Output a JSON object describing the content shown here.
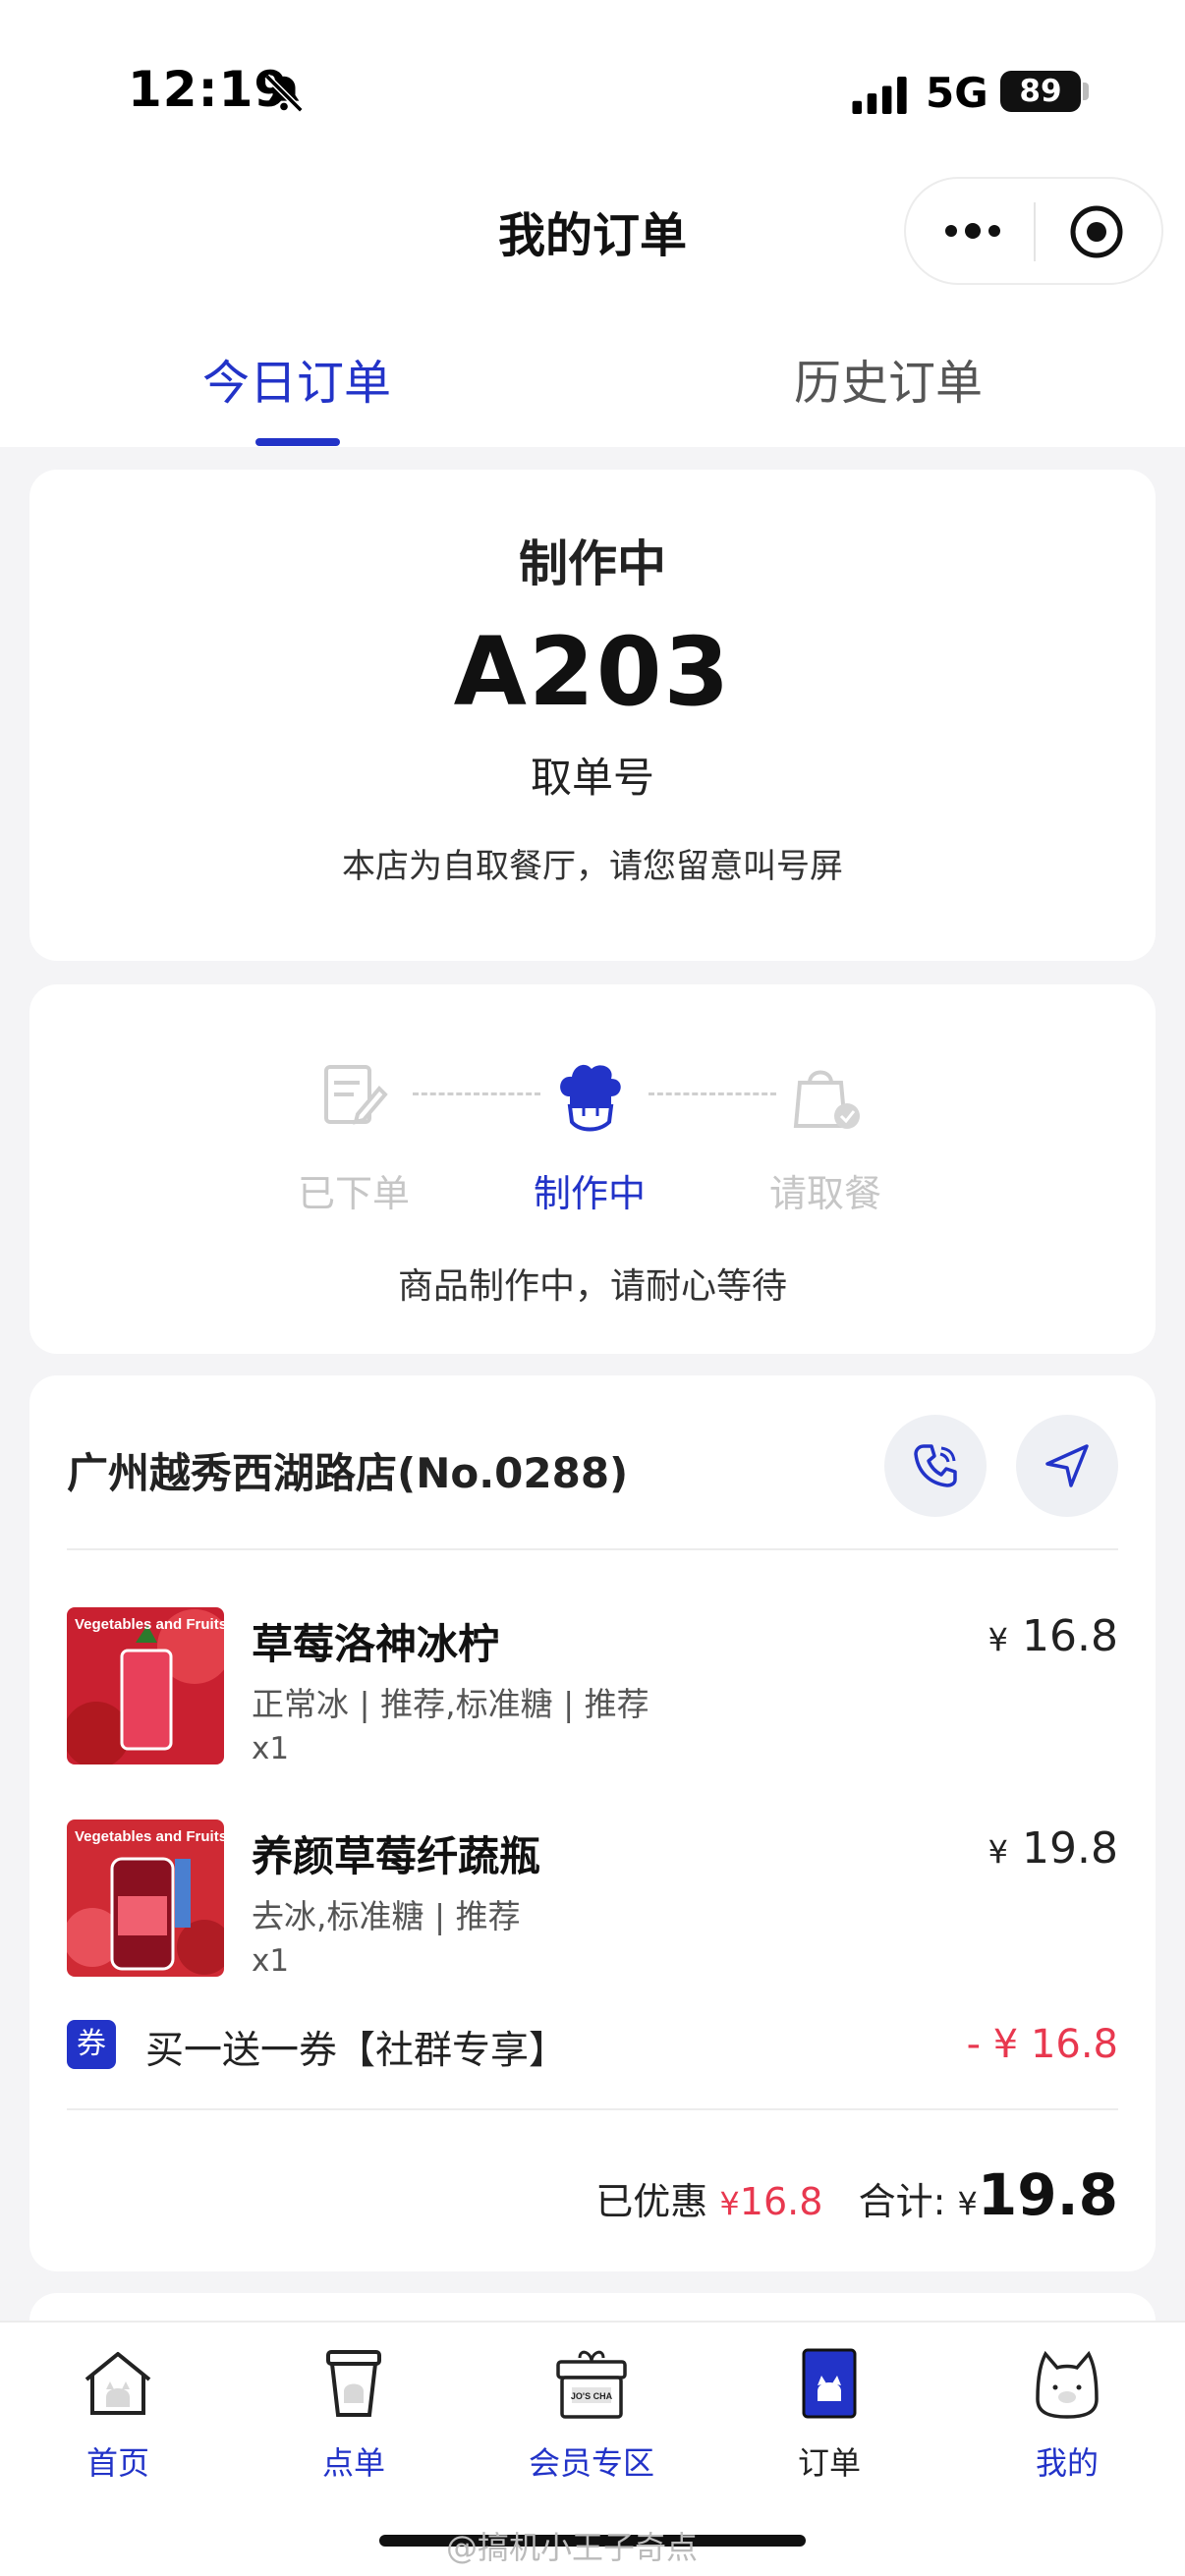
{
  "status_bar": {
    "time": "12:19",
    "network": "5G",
    "battery": "89"
  },
  "nav": {
    "title": "我的订单"
  },
  "tabs": [
    {
      "label": "今日订单",
      "active": true
    },
    {
      "label": "历史订单",
      "active": false
    }
  ],
  "order_status": {
    "status": "制作中",
    "pickup_number": "A203",
    "pickup_label": "取单号",
    "note": "本店为自取餐厅，请您留意叫号屏"
  },
  "progress": {
    "steps": [
      {
        "label": "已下单"
      },
      {
        "label": "制作中"
      },
      {
        "label": "请取餐"
      }
    ],
    "current_step": 2,
    "note": "商品制作中，请耐心等待"
  },
  "store": {
    "name": "广州越秀西湖路店(No.0288)",
    "items": [
      {
        "name": "草莓洛神冰柠",
        "spec": "正常冰 | 推荐,标准糖 | 推荐",
        "qty": "x1",
        "currency": "¥",
        "price": "16.8",
        "thumb_text": "Vegetables and Fruits Tea"
      },
      {
        "name": "养颜草莓纤蔬瓶",
        "spec": "去冰,标准糖 | 推荐",
        "qty": "x1",
        "currency": "¥",
        "price": "19.8",
        "thumb_text": "Vegetables and Fruits Tea"
      }
    ],
    "coupon": {
      "badge": "券",
      "text": "买一送一券【社群专享】",
      "amount": "- ¥ 16.8"
    },
    "summary": {
      "discount_label": "已优惠",
      "discount_currency": "¥",
      "discount_amount": "16.8",
      "total_label": "合计:",
      "total_currency": "¥",
      "total_amount": "19.8"
    }
  },
  "tabbar": [
    {
      "label": "首页",
      "icon": "home-icon",
      "active": false
    },
    {
      "label": "点单",
      "icon": "cup-icon",
      "active": false
    },
    {
      "label": "会员专区",
      "icon": "gift-box-icon",
      "active": false,
      "box_text": "JO'S CHA"
    },
    {
      "label": "订单",
      "icon": "order-icon",
      "active": true
    },
    {
      "label": "我的",
      "icon": "cat-face-icon",
      "active": false
    }
  ],
  "watermark": "@搞机小王子奇点",
  "colors": {
    "accent": "#2233c8",
    "price_red": "#e8384f",
    "background": "#f4f4f6"
  }
}
